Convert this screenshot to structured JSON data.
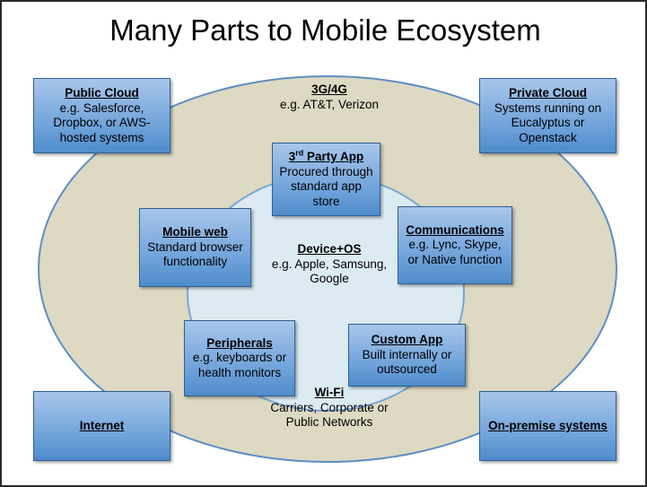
{
  "title": "Many Parts to Mobile Ecosystem",
  "colors": {
    "outer_ellipse_fill": "#ddd9c3",
    "outer_ellipse_border": "#5b8ec4",
    "inner_ellipse_fill": "#dceaf2",
    "inner_ellipse_border": "#7aa6d0",
    "box_fill_top": "#a8c6ea",
    "box_fill_bottom": "#4f8ccb",
    "box_border": "#2e5f94",
    "text": "#000000",
    "frame_border": "#2b2b2b"
  },
  "regions": {
    "outer_label": "network-layer-ellipse",
    "inner_label": "device-layer-ellipse"
  },
  "boxes": [
    {
      "id": "public-cloud",
      "heading": "Public Cloud",
      "body": "e.g. Salesforce, Dropbox, or AWS-hosted systems"
    },
    {
      "id": "private-cloud",
      "heading": "Private Cloud",
      "body": "Systems running on Eucalyptus or Openstack"
    },
    {
      "id": "third-party-app",
      "heading_prefix": "3",
      "heading_sup": "rd",
      "heading_suffix": " Party App",
      "heading": "3rd Party App",
      "body": "Procured through standard app store"
    },
    {
      "id": "mobile-web",
      "heading": "Mobile web",
      "body": "Standard browser functionality"
    },
    {
      "id": "communications",
      "heading": "Communications",
      "body": "e.g. Lync, Skype, or Native function"
    },
    {
      "id": "peripherals",
      "heading": "Peripherals",
      "body": "e.g. keyboards or health monitors"
    },
    {
      "id": "custom-app",
      "heading": "Custom App",
      "body": "Built internally or outsourced"
    },
    {
      "id": "internet",
      "heading": "Internet",
      "body": ""
    },
    {
      "id": "on-premise-systems",
      "heading": "On-premise systems",
      "body": ""
    }
  ],
  "labels": [
    {
      "id": "3g-4g",
      "heading": "3G/4G",
      "body": "e.g. AT&T, Verizon"
    },
    {
      "id": "device-os",
      "heading": "Device+OS",
      "body": "e.g. Apple, Samsung, Google"
    },
    {
      "id": "wi-fi",
      "heading": "Wi-Fi",
      "body": "Carriers, Corporate or Public Networks"
    }
  ]
}
